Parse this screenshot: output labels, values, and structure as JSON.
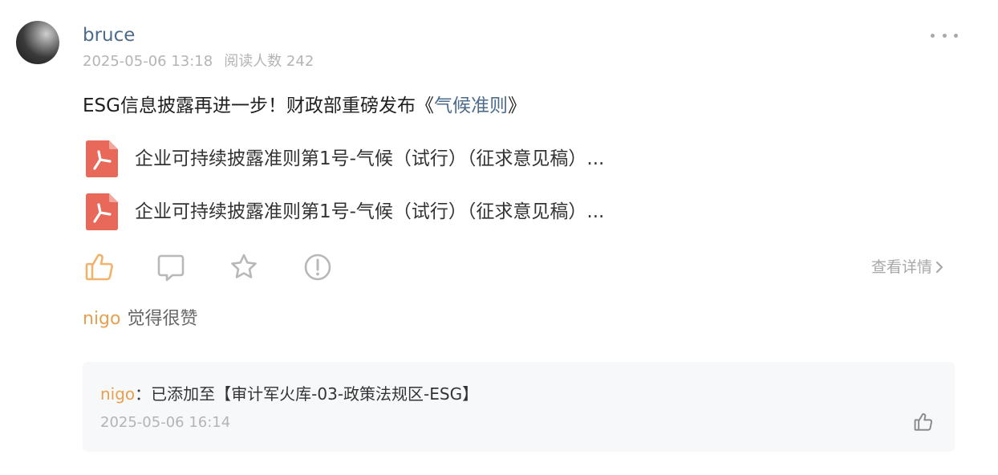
{
  "post": {
    "author": "bruce",
    "date": "2025-05-06 13:18",
    "readers_label": "阅读人数 242",
    "text_prefix": "ESG信息披露再进一步！财政部重磅发布《",
    "text_link": "气候准则",
    "text_suffix": "》",
    "attachments": [
      {
        "name": "企业可持续披露准则第1号-气候（试行）（征求意见稿）...",
        "icon": "pdf-icon"
      },
      {
        "name": "企业可持续披露准则第1号-气候（试行）（征求意见稿）...",
        "icon": "pdf-icon"
      }
    ],
    "details_label": "查看详情"
  },
  "likes": {
    "user": "nigo",
    "text": "觉得很赞"
  },
  "comment": {
    "author": "nigo",
    "separator": "：",
    "text": "已添加至【审计军火库-03-政策法规区-ESG】",
    "time": "2025-05-06 16:14"
  },
  "colors": {
    "link_blue": "#4d6b8a",
    "like_orange": "#e8a04f",
    "pdf_red": "#e8685a",
    "meta_gray": "#b4b4b4"
  }
}
